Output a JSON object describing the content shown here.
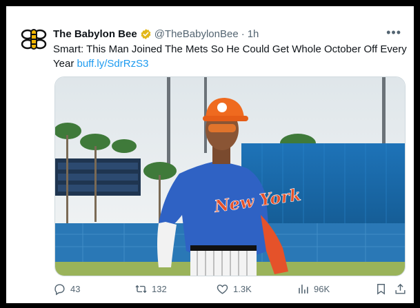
{
  "tweet": {
    "account_name": "The Babylon Bee",
    "handle": "@TheBabylonBee",
    "separator": "·",
    "time": "1h",
    "text": "Smart: This Man Joined The Mets So He Could Get Whole October Off Every Year",
    "link": "buff.ly/SdrRzS3"
  },
  "media": {
    "jersey_text": "New York"
  },
  "actions": {
    "replies": "43",
    "retweets": "132",
    "likes": "1.3K",
    "views": "96K"
  },
  "colors": {
    "link": "#1d9bf0",
    "secondary_text": "#536471",
    "verified_badge": "#e2b719"
  },
  "icons": [
    "bee-logo-icon",
    "verified-badge-icon",
    "more-options-icon",
    "reply-icon",
    "retweet-icon",
    "like-icon",
    "views-icon",
    "bookmark-icon",
    "share-icon"
  ]
}
